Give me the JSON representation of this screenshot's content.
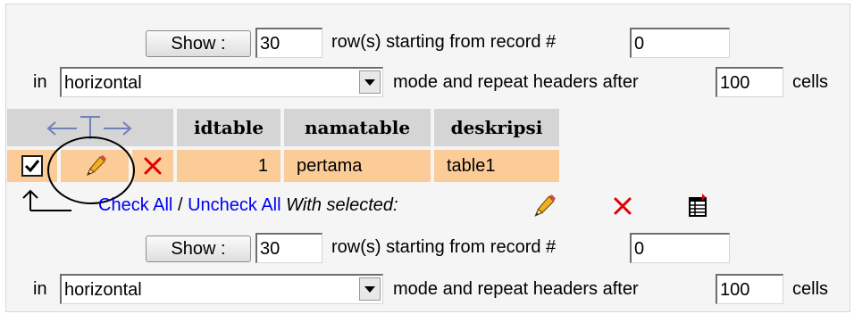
{
  "nav_top": {
    "show_label": "Show :",
    "rows_value": "30",
    "rows_text": "row(s) starting from record #",
    "start_value": "0",
    "in_text": "in",
    "mode_value": "horizontal",
    "repeat_text": "mode and repeat headers after",
    "repeat_value": "100",
    "cells_text": "cells"
  },
  "table": {
    "headers": [
      "idtable",
      "namatable",
      "deskripsi"
    ],
    "rows": [
      {
        "idtable": "1",
        "namatable": "pertama",
        "deskripsi": "table1",
        "checked": true
      }
    ]
  },
  "selection": {
    "check_all": "Check All",
    "separator": "/",
    "uncheck_all": "Uncheck All",
    "with_selected": "With selected:"
  },
  "nav_bottom": {
    "show_label": "Show :",
    "rows_value": "30",
    "rows_text": "row(s) starting from record #",
    "start_value": "0",
    "in_text": "in",
    "mode_value": "horizontal",
    "repeat_text": "mode and repeat headers after",
    "repeat_value": "100",
    "cells_text": "cells"
  },
  "colors": {
    "header_bg": "#d5d5d5",
    "row_bg": "#fbcc98",
    "link": "#0000ee",
    "delete_red": "#e00000"
  }
}
